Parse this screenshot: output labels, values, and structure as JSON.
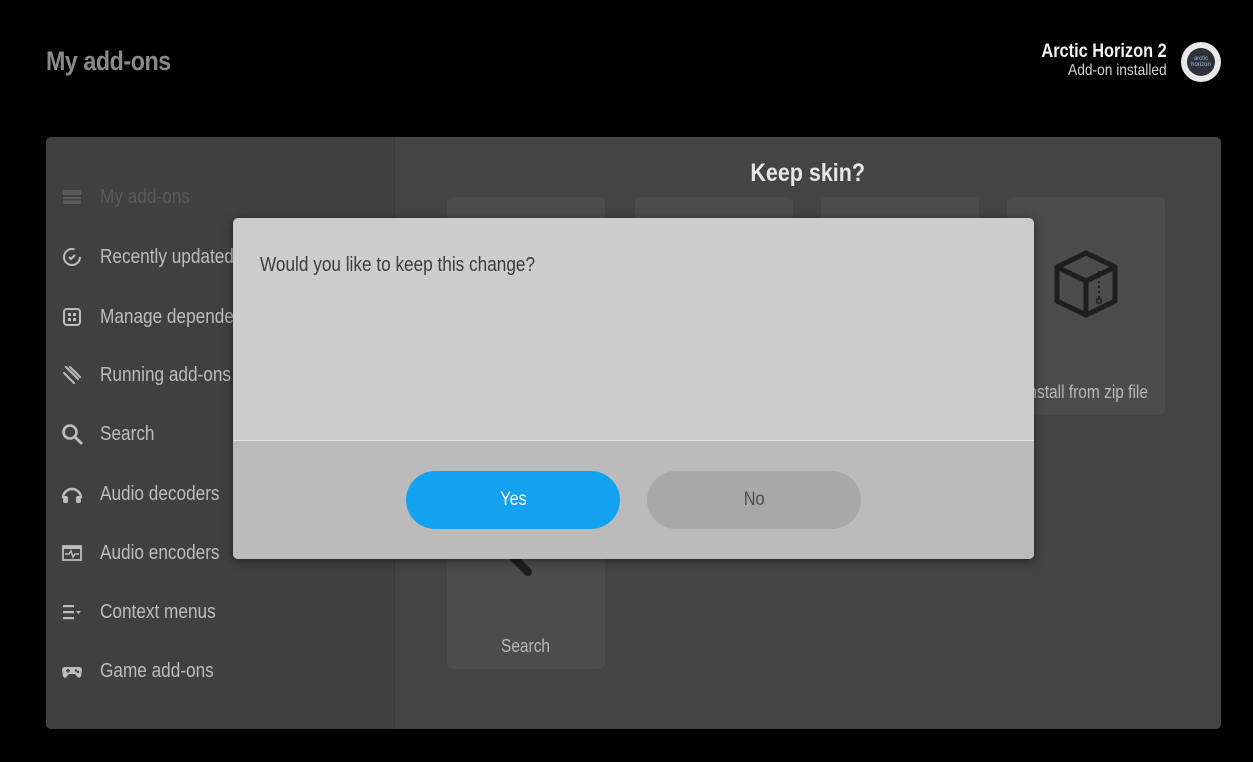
{
  "header": {
    "title": "My add-ons"
  },
  "notification": {
    "title": "Arctic Horizon 2",
    "subtitle": "Add-on installed",
    "logo_text": "arctic horizon",
    "icon": "arctic-horizon-logo-icon"
  },
  "sidebar": {
    "items": [
      {
        "label": "My add-ons",
        "icon": "addons-box-icon"
      },
      {
        "label": "Recently updated",
        "icon": "refresh-clock-icon"
      },
      {
        "label": "Manage dependencies",
        "icon": "dependencies-icon"
      },
      {
        "label": "Running add-ons",
        "icon": "running-icon"
      },
      {
        "label": "Search",
        "icon": "search-icon"
      },
      {
        "label": "Audio decoders",
        "icon": "headphones-icon"
      },
      {
        "label": "Audio encoders",
        "icon": "waveform-icon"
      },
      {
        "label": "Context menus",
        "icon": "context-menu-icon"
      },
      {
        "label": "Game add-ons",
        "icon": "gamepad-icon"
      }
    ]
  },
  "content": {
    "title": "Keep skin?",
    "tiles": [
      {
        "label": "Install from zip file",
        "icon": "zip-box-icon"
      },
      {
        "label": "Search",
        "icon": "search-icon"
      }
    ]
  },
  "dialog": {
    "message": "Would you like to keep this change?",
    "yes_label": "Yes",
    "no_label": "No"
  },
  "colors": {
    "accent": "#13a2f0",
    "background": "#000000",
    "panel": "#444444",
    "dialog": "#cdcdcd"
  }
}
